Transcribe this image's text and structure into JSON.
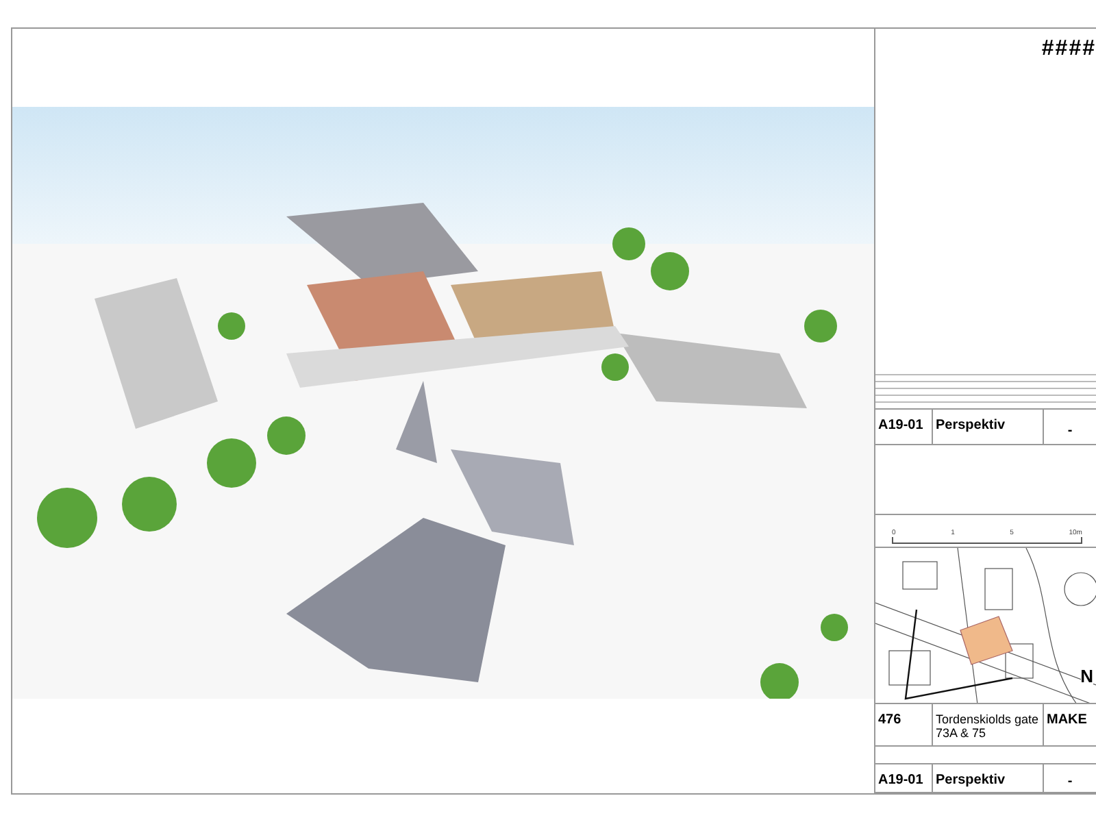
{
  "sheet_code": "####",
  "upper_block": {
    "drawing_number": "A19-01",
    "title": "Perspektiv",
    "revision": "-"
  },
  "scale_bar": {
    "ticks": [
      "0",
      "1",
      "5",
      "10m"
    ]
  },
  "map": {
    "north": "N"
  },
  "lower_block": {
    "project_number": "476",
    "project_name": "Tordenskiolds gate 73A & 75",
    "company": "MAKE",
    "drawing_number": "A19-01",
    "title": "Perspektiv",
    "revision": "-"
  }
}
